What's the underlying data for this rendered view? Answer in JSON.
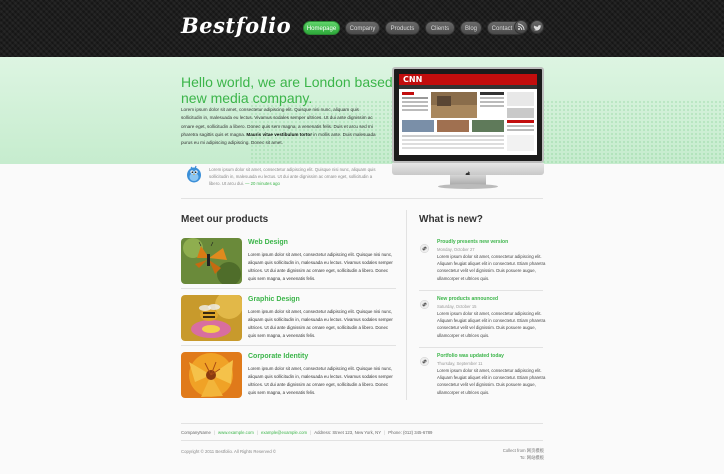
{
  "header": {
    "logo": "Bestfolio",
    "nav": [
      "Homepage",
      "Company",
      "Products",
      "Clients",
      "Blog",
      "Contact us"
    ],
    "active_nav": "Homepage",
    "social_icons": [
      "rss-icon",
      "twitter-icon"
    ]
  },
  "hero": {
    "title": "Hello world, we are London based new media company.",
    "text_before": "Lorem ipsum dolor sit amet, consectetur adipiscing elit. Quisque nisi nunc, aliquam quis sollicitudin in, malesuada eu lectus. Vivamus sodales semper ultrices. Ut dui ante dignissim ac ornare eget, sollicitudin a libero. Donec quis sem magna, a venenatis felis. Duis et arcu sed mi pharetra sagittis quis et magna.",
    "text_bold": "Mauris vitae vestibulum tortor",
    "text_after": "in mollis ante. Duis malesuada purus eu mi adipiscing adipiscing. Donec sit amet.",
    "tweet_text": "Lorem ipsum dolor sit amet, consectetur adipiscing elit. Quisque nisi nunc, aliquam quis sollicitudin in, malesuada eu lectus. Ut dui ante dignissim ac ornare eget, sollicitudin a libero. Ut arcu dui.",
    "tweet_time": "— 20 minutes ago"
  },
  "products": {
    "title": "Meet our products",
    "items": [
      {
        "title": "Web Design",
        "text": "Lorem ipsum dolor sit amet, consectetur adipiscing elit. Quisque nisi nunc, aliquam quis sollicitudin in, malesuada eu lectus. Vivamus sodales semper ultrices. Ut dui ante dignissim ac ornare eget, sollicitudin a libero. Donec quis sem magna, a venenatis felis."
      },
      {
        "title": "Graphic Design",
        "text": "Lorem ipsum dolor sit amet, consectetur adipiscing elit. Quisque nisi nunc, aliquam quis sollicitudin in, malesuada eu lectus. Vivamus sodales semper ultrices. Ut dui ante dignissim ac ornare eget, sollicitudin a libero. Donec quis sem magna, a venenatis felis."
      },
      {
        "title": "Corporate Identity",
        "text": "Lorem ipsum dolor sit amet, consectetur adipiscing elit. Quisque nisi nunc, aliquam quis sollicitudin in, malesuada eu lectus. Vivamus sodales semper ultrices. Ut dui ante dignissim ac ornare eget, sollicitudin a libero. Donec quis sem magna, a venenatis felis."
      }
    ]
  },
  "news": {
    "title": "What is new?",
    "items": [
      {
        "title": "Proudly presents new version",
        "date": "Monday, October 27",
        "text": "Lorem ipsum dolor sit amet, consectetur adipiscing elit. Aliquam feugiat aliquet elit in consectetur. Etiam pharetra consectetur velit vel dignissim. Duis posuere augue, ullamcorper et ultrices quis."
      },
      {
        "title": "New products announced",
        "date": "Saturday, October 15",
        "text": "Lorem ipsum dolor sit amet, consectetur adipiscing elit. Aliquam feugiat aliquet elit in consectetur. Etiam pharetra consectetur velit vel dignissim. Duis posuere augue, ullamcorper et ultrices quis."
      },
      {
        "title": "Portfolio was updated today",
        "date": "Thursday, September 11",
        "text": "Lorem ipsum dolor sit amet, consectetur adipiscing elit. Aliquam feugiat aliquet elit in consectetur. Etiam pharetra consectetur velit vel dignissim. Duis posuere augue, ullamcorper et ultrices quis."
      }
    ]
  },
  "footer": {
    "company": "CompanyName",
    "website": "www.example.com",
    "email": "example@example.com",
    "address": "Address: Street 123, New York, NY",
    "phone": "Phone: (012) 345-6789",
    "copyright": "Copyright © 2011 Bestfolio. All Rights Reserved ©",
    "credit_line1": "Collect from 网页模板",
    "credit_line2": "To: 网站模板"
  },
  "monitor_screen": {
    "site_logo": "CNN"
  },
  "colors": {
    "accent": "#3cb54a",
    "header_bg": "#1d1d1d",
    "hero_bg": "#d4f1da"
  }
}
